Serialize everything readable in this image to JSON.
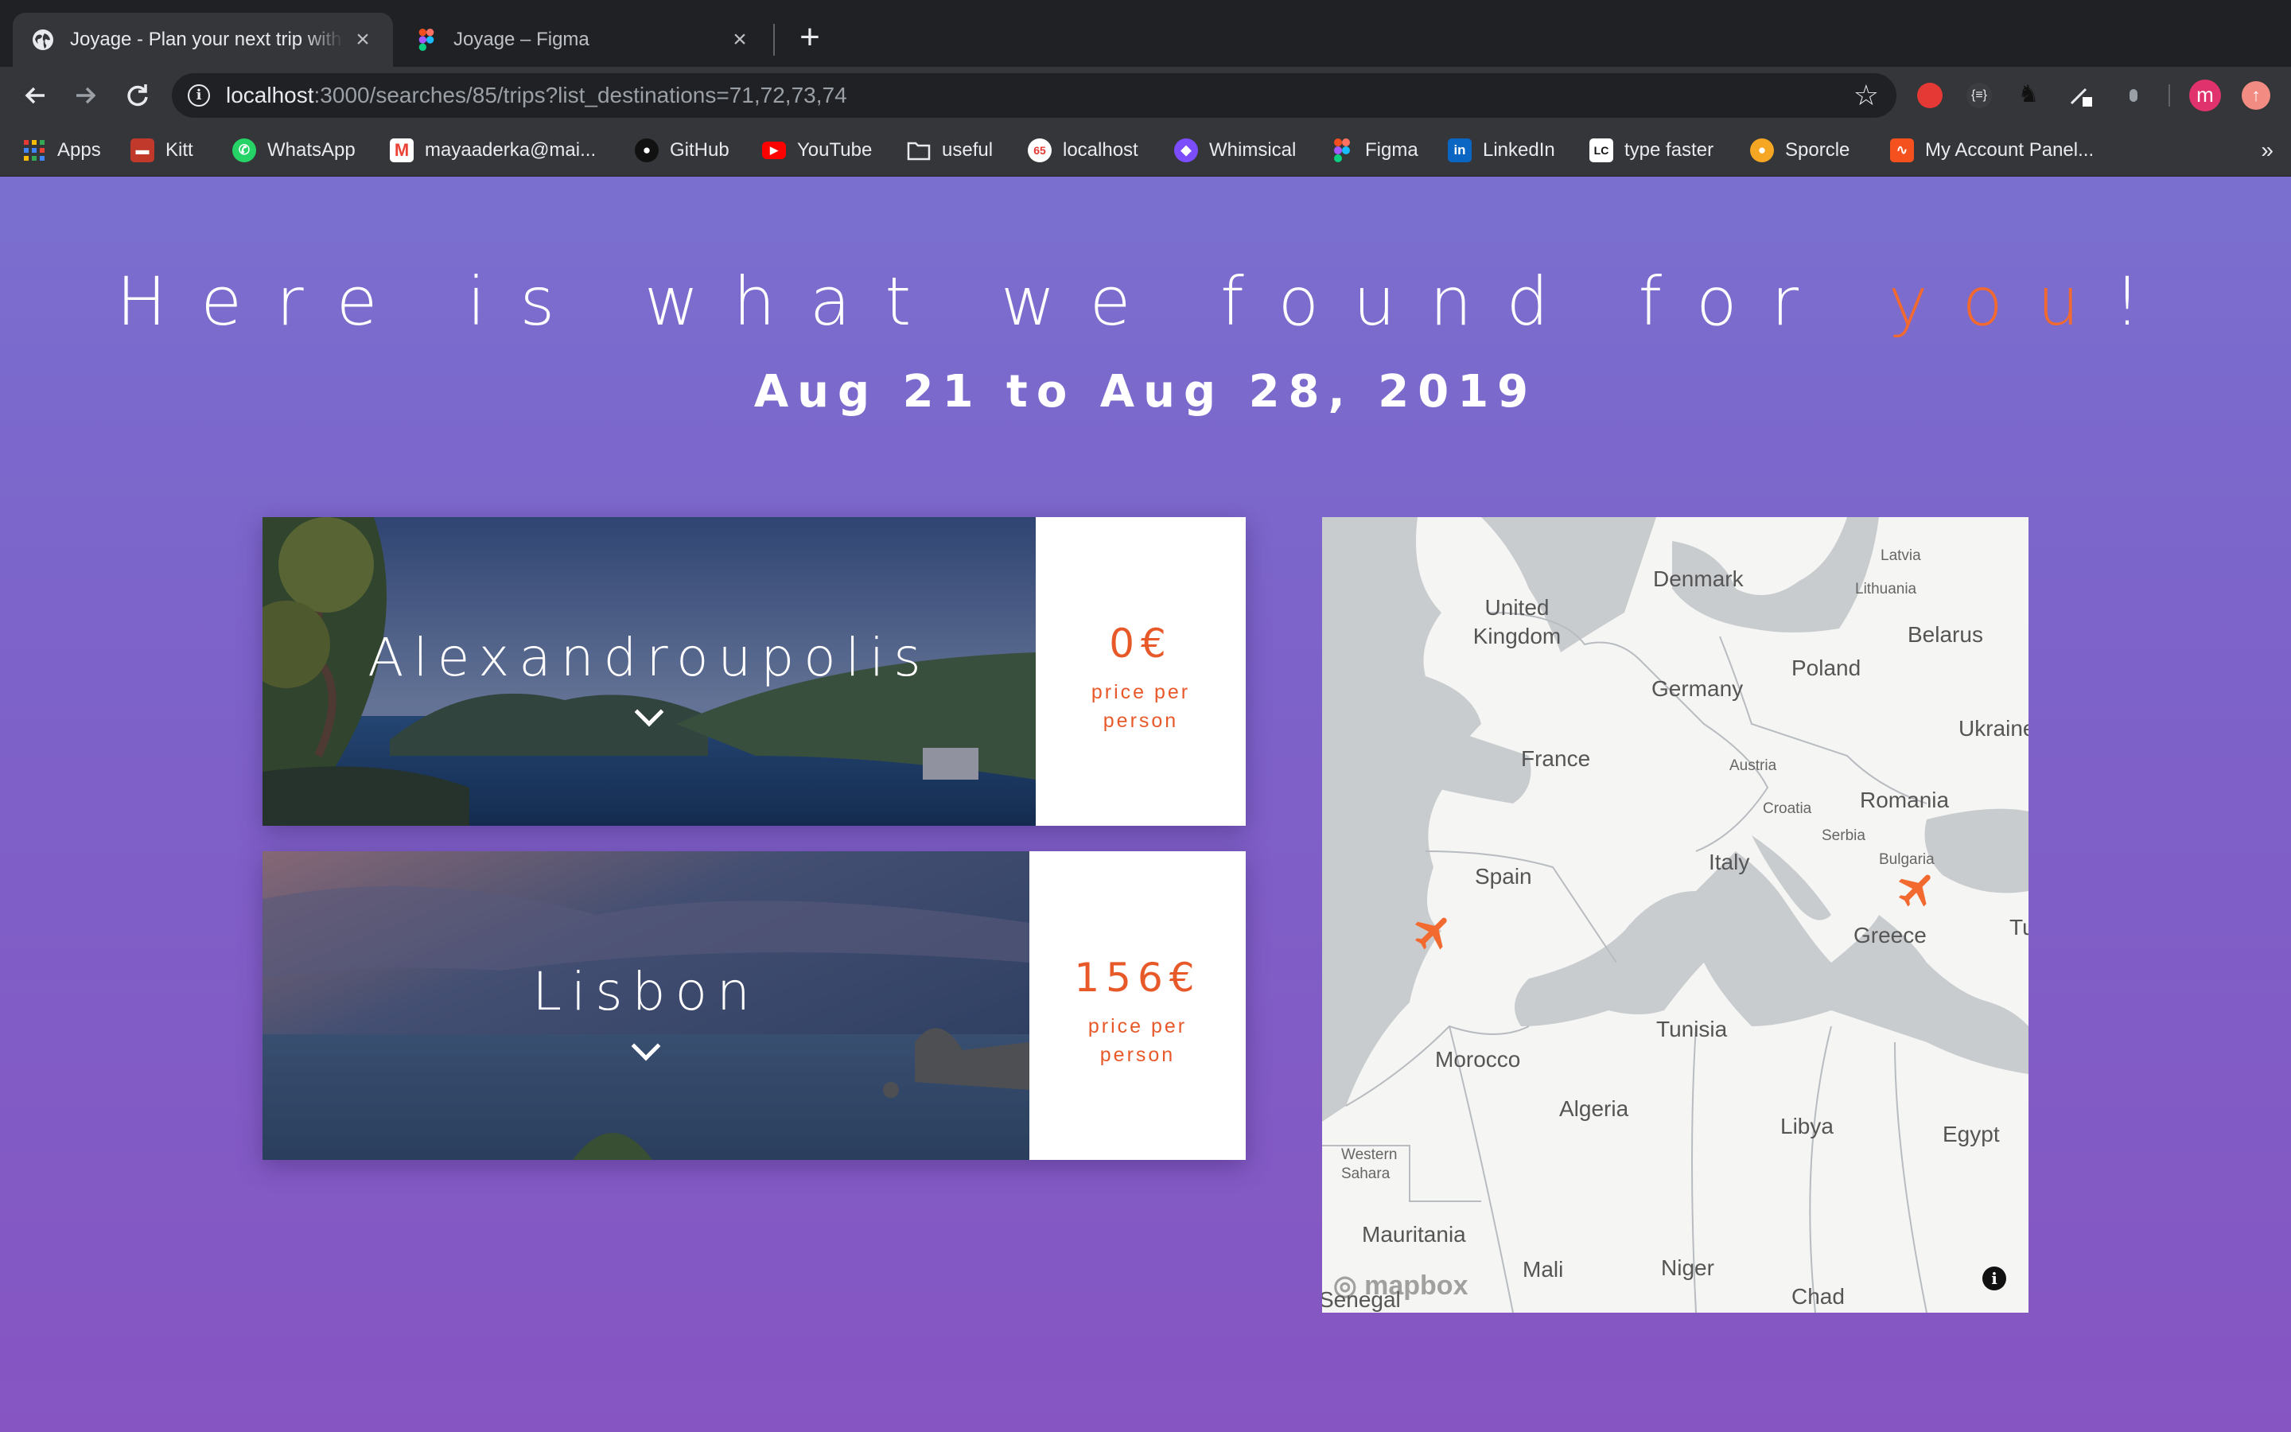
{
  "browser": {
    "tabs": [
      {
        "title": "Joyage - Plan your next trip with friends",
        "active": true,
        "favicon": "globe-icon"
      },
      {
        "title": "Joyage – Figma",
        "active": false,
        "favicon": "figma-icon"
      }
    ],
    "address": {
      "host": "localhost",
      "path": ":3000/searches/85/trips?list_destinations=71,72,73,74"
    },
    "avatar_letter": "m",
    "bookmarks": [
      {
        "label": "Apps",
        "icon": "apps-grid-icon",
        "color": "#4285f4"
      },
      {
        "label": "Kitt",
        "icon": "kitt-icon",
        "color": "#c0392b"
      },
      {
        "label": "WhatsApp",
        "icon": "whatsapp-icon",
        "color": "#25d366"
      },
      {
        "label": "mayaaderka@mai...",
        "icon": "gmail-icon",
        "color": "#ea4335"
      },
      {
        "label": "GitHub",
        "icon": "github-icon",
        "color": "#24292e"
      },
      {
        "label": "YouTube",
        "icon": "youtube-icon",
        "color": "#ff0000"
      },
      {
        "label": "useful",
        "icon": "folder-icon",
        "color": "#9aa0a6"
      },
      {
        "label": "localhost",
        "icon": "localhost-icon",
        "color": "#e53935"
      },
      {
        "label": "Whimsical",
        "icon": "whimsical-icon",
        "color": "#7c4dff"
      },
      {
        "label": "Figma",
        "icon": "figma-icon",
        "color": "#f24e1e"
      },
      {
        "label": "LinkedIn",
        "icon": "linkedin-icon",
        "color": "#0a66c2"
      },
      {
        "label": "type faster",
        "icon": "lc-icon",
        "color": "#ffffff"
      },
      {
        "label": "Sporcle",
        "icon": "sporcle-icon",
        "color": "#f5a623"
      },
      {
        "label": "My Account Panel...",
        "icon": "account-panel-icon",
        "color": "#f4511e"
      }
    ]
  },
  "page": {
    "headline_prefix": "Here is what we found for ",
    "headline_accent": "you",
    "headline_suffix": "!",
    "dates": "Aug 21 to Aug 28, 2019",
    "accent_color": "#f26a2f",
    "price_color": "#e8592a",
    "trips": [
      {
        "city": "Alexandroupolis",
        "price": "0€",
        "price_label": "price per person"
      },
      {
        "city": "Lisbon",
        "price": "156€",
        "price_label": "price per person"
      }
    ],
    "map": {
      "labels": [
        "Denmark",
        "Latvia",
        "Lithuania",
        "United Kingdom",
        "Belarus",
        "Poland",
        "Germany",
        "Ukraine",
        "France",
        "Austria",
        "Romania",
        "Croatia",
        "Serbia",
        "Italy",
        "Bulgaria",
        "Spain",
        "Greece",
        "Tu",
        "Tunisia",
        "Morocco",
        "Algeria",
        "Libya",
        "Egypt",
        "Western Sahara",
        "Mauritania",
        "Mali",
        "Niger",
        "Chad",
        "Senegal"
      ],
      "attribution": "mapbox"
    }
  }
}
